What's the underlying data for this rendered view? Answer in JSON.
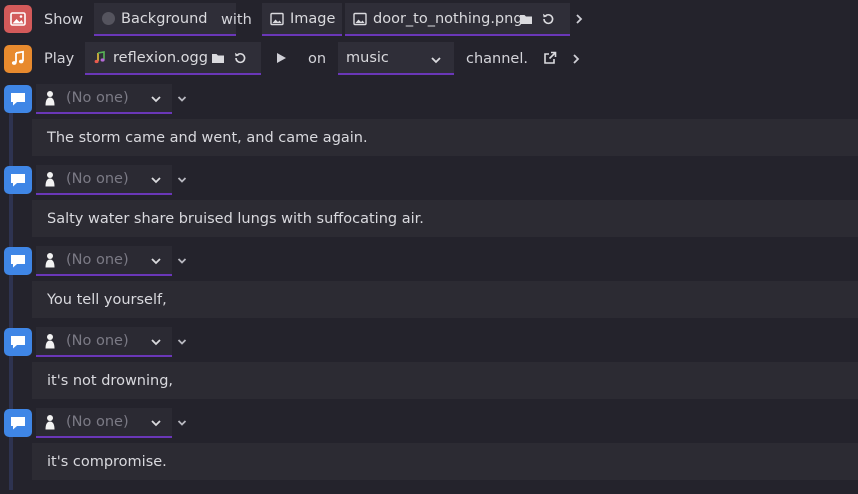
{
  "show_event": {
    "show_label": "Show",
    "target_label": "Background",
    "with_label": "with",
    "type_label": "Image",
    "file_name": "door_to_nothing.png"
  },
  "play_event": {
    "play_label": "Play",
    "file_name": "reflexion.ogg",
    "on_label": "on",
    "channel_value": "music",
    "channel_suffix": "channel."
  },
  "text_events": [
    {
      "character": "(No one)",
      "text": "The storm came and went, and came again."
    },
    {
      "character": "(No one)",
      "text": "Salty water share bruised lungs with suffocating air."
    },
    {
      "character": "(No one)",
      "text": "You tell yourself,"
    },
    {
      "character": "(No one)",
      "text": "it's not drowning,"
    },
    {
      "character": "(No one)",
      "text": "it's compromise."
    }
  ],
  "colors": {
    "background": "#24232c",
    "accent": "#6a37b8",
    "show_icon": "#d35a5a",
    "play_icon": "#e88a2e",
    "text_icon": "#3f86e6"
  },
  "icons": [
    "image-icon",
    "music-note-icon",
    "speech-bubble-icon",
    "folder-icon",
    "reset-icon",
    "play-icon",
    "chevron-down-icon",
    "chevron-right-icon",
    "external-link-icon",
    "person-icon"
  ]
}
